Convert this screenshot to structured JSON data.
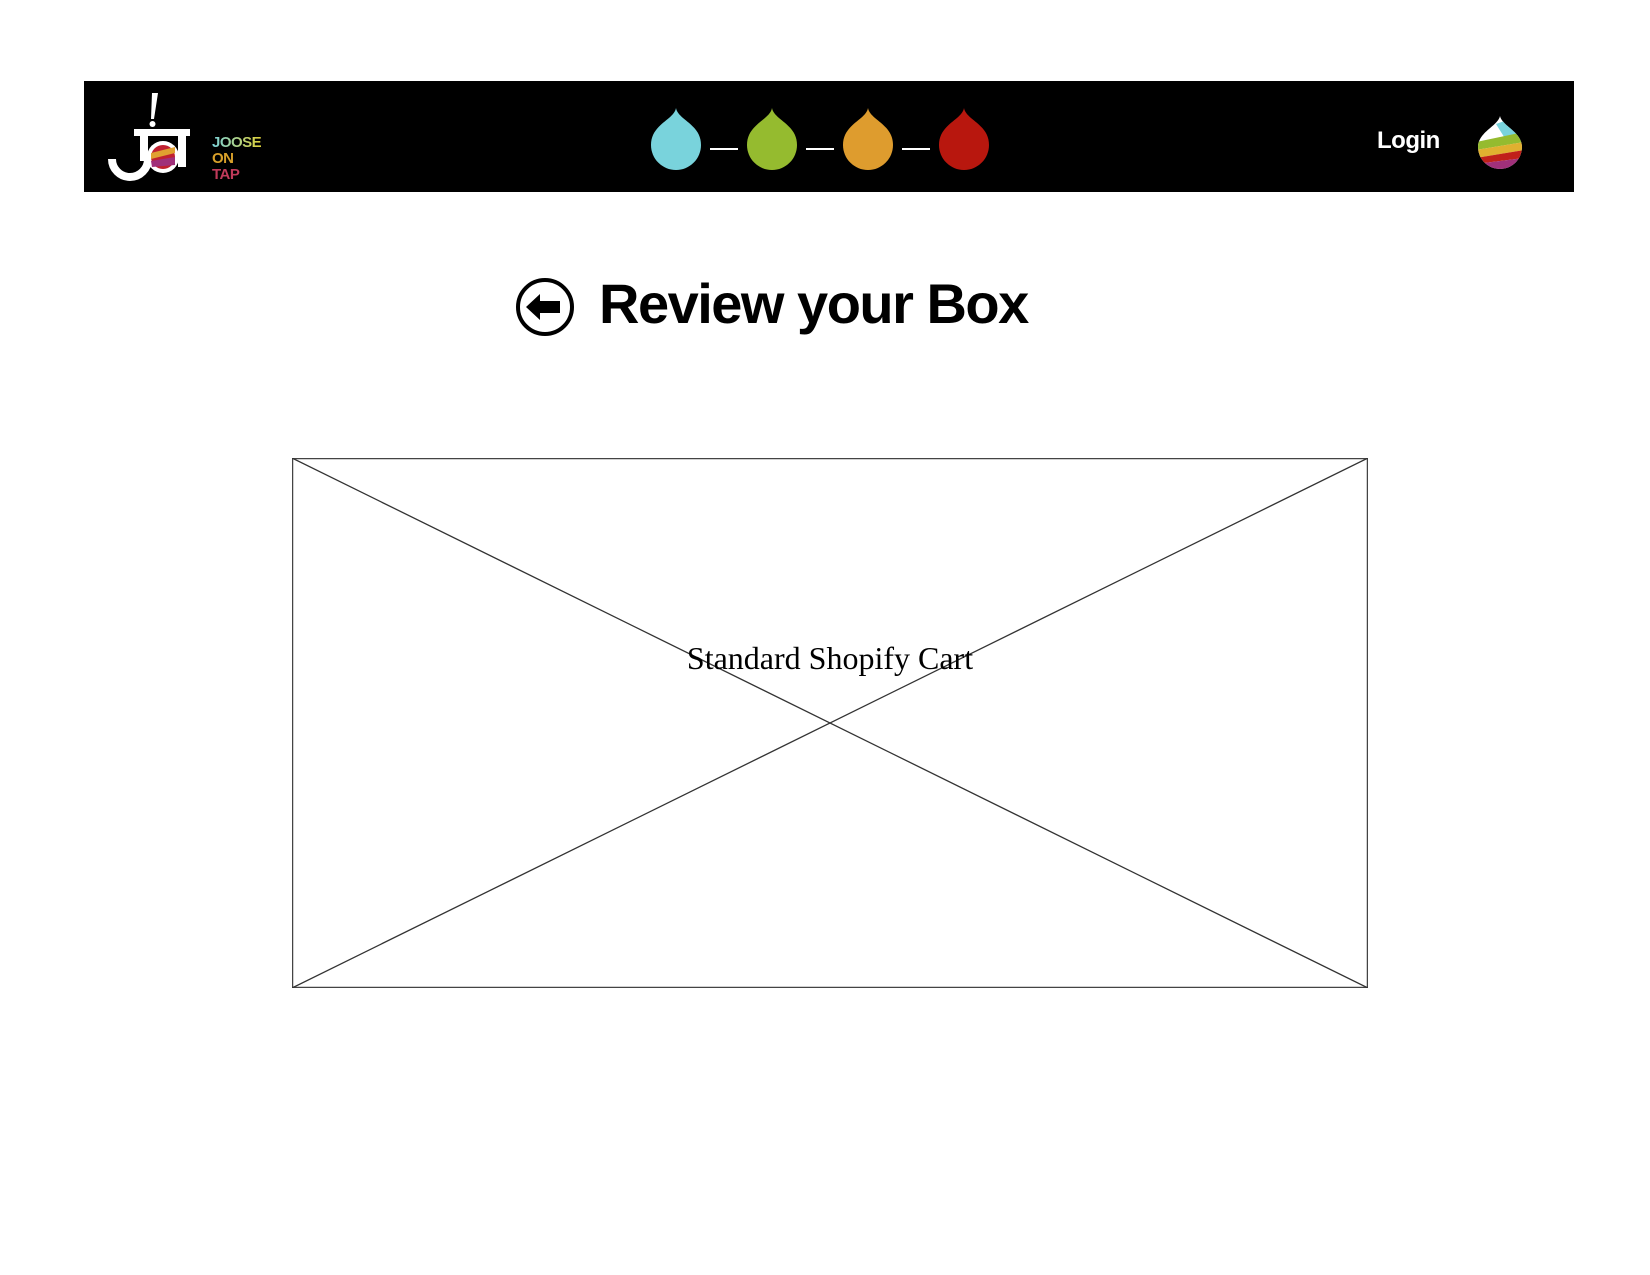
{
  "header": {
    "logo": {
      "text_lines": [
        "JOOSE",
        "ON",
        "TAP"
      ],
      "monogram": "JOT"
    },
    "steps": [
      {
        "name": "step-1",
        "color": "#79d3dc"
      },
      {
        "name": "step-2",
        "color": "#95bb2f"
      },
      {
        "name": "step-3",
        "color": "#de9c2e"
      },
      {
        "name": "step-4",
        "color": "#b8170e"
      }
    ],
    "login_label": "Login",
    "account_icon": "rainbow-drop-icon"
  },
  "main": {
    "back_icon": "back-arrow-circle-icon",
    "title": "Review your Box",
    "placeholder_label": "Standard Shopify Cart"
  }
}
